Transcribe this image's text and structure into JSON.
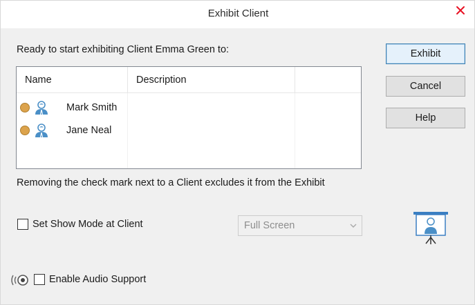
{
  "window": {
    "title": "Exhibit Client",
    "close_icon": "close-icon"
  },
  "prompt": "Ready to start exhibiting Client Emma Green to:",
  "client_list": {
    "columns": [
      "Name",
      "Description"
    ],
    "rows": [
      {
        "name": "Mark Smith",
        "description": "",
        "status_color": "#dca34c",
        "icon": "user-icon"
      },
      {
        "name": "Jane Neal",
        "description": "",
        "status_color": "#dca34c",
        "icon": "user-icon"
      }
    ]
  },
  "buttons": {
    "exhibit": "Exhibit",
    "cancel": "Cancel",
    "help": "Help"
  },
  "note": "Removing the check mark next to a Client excludes it from the Exhibit",
  "show_mode": {
    "label": "Set Show Mode at Client",
    "checked": false,
    "selected_option": "Full Screen",
    "enabled": false
  },
  "audio": {
    "label": "Enable Audio Support",
    "checked": false,
    "icon": "speaker-icon"
  },
  "presentation_icon": "presentation-icon",
  "colors": {
    "accent": "#3c7fb1",
    "status_dot": "#dca34c",
    "user_icon": "#4a8fc7",
    "close_icon": "#e81123"
  }
}
